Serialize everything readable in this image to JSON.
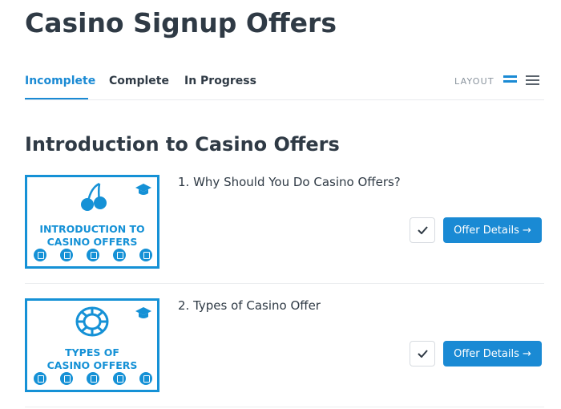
{
  "page": {
    "title": "Casino Signup Offers"
  },
  "tabs": [
    {
      "label": "Incomplete",
      "active": true
    },
    {
      "label": "Complete",
      "active": false
    },
    {
      "label": "In Progress",
      "active": false
    }
  ],
  "layout": {
    "label": "LAYOUT",
    "options": [
      "grid-icon",
      "list-icon"
    ],
    "selected": "grid-icon"
  },
  "section": {
    "title": "Introduction to Casino Offers"
  },
  "offers": [
    {
      "title": "1. Why Should You Do Casino Offers?",
      "thumbnail": {
        "line1": "INTRODUCTION TO",
        "line2": "CASINO OFFERS",
        "graphic": "cherries-icon"
      },
      "details_label": "Offer Details →",
      "check_icon": "checkmark-icon"
    },
    {
      "title": "2. Types of Casino Offer",
      "thumbnail": {
        "line1": "TYPES OF",
        "line2": "CASINO OFFERS",
        "graphic": "casino-chip-icon"
      },
      "details_label": "Offer Details →",
      "check_icon": "checkmark-icon"
    }
  ],
  "colors": {
    "accent": "#1a8ad4",
    "thumb_blue": "#1591d6",
    "text": "#2f3a45",
    "muted": "#8a949e"
  }
}
